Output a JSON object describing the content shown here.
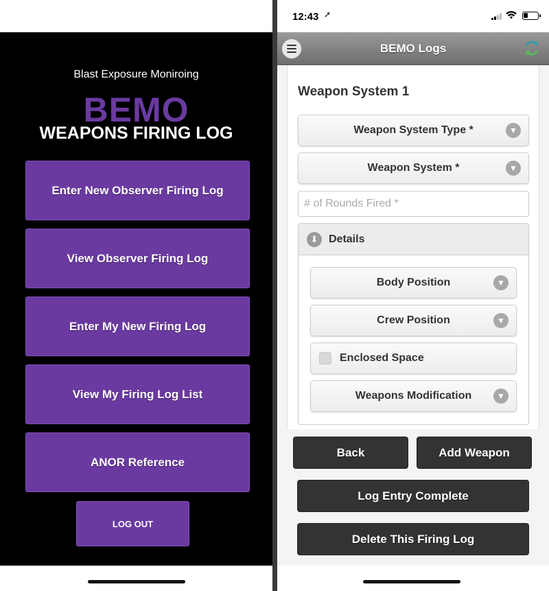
{
  "left_screen": {
    "subtitle": "Blast Exposure Moniroing",
    "logo_text": "BEMO",
    "app_title": "WEAPONS FIRING LOG",
    "menu_buttons": [
      {
        "label": "Enter New Observer Firing Log"
      },
      {
        "label": "View Observer Firing Log"
      },
      {
        "label": "Enter My New Firing Log"
      },
      {
        "label": "View My Firing Log List"
      },
      {
        "label": "ANOR Reference"
      }
    ],
    "logout_label": "LOG OUT"
  },
  "right_screen": {
    "status_bar": {
      "time": "12:43",
      "location_icon": "location-arrow-icon",
      "signal_icon": "signal-icon",
      "wifi_icon": "wifi-icon",
      "battery_icon": "battery-icon",
      "battery_level": 0.25
    },
    "header": {
      "title": "BEMO Logs",
      "menu_icon": "hamburger-menu-icon",
      "sync_icon": "sync-icon"
    },
    "form": {
      "section_title": "Weapon System 1",
      "weapon_system_type": "Weapon System Type *",
      "weapon_system": "Weapon System *",
      "rounds_fired_placeholder": "# of Rounds Fired *",
      "details": {
        "label": "Details",
        "body_position": "Body Position",
        "crew_position": "Crew Position",
        "enclosed_space": "Enclosed Space",
        "enclosed_space_checked": false,
        "weapons_modification": "Weapons Modification"
      }
    },
    "buttons": {
      "back": "Back",
      "add_weapon": "Add Weapon",
      "log_entry_complete": "Log Entry Complete",
      "delete_log": "Delete This Firing Log"
    }
  },
  "colors": {
    "brand_purple": "#6a3aa0",
    "dark_button": "#333333",
    "header_gray": "#8a8a8a"
  }
}
